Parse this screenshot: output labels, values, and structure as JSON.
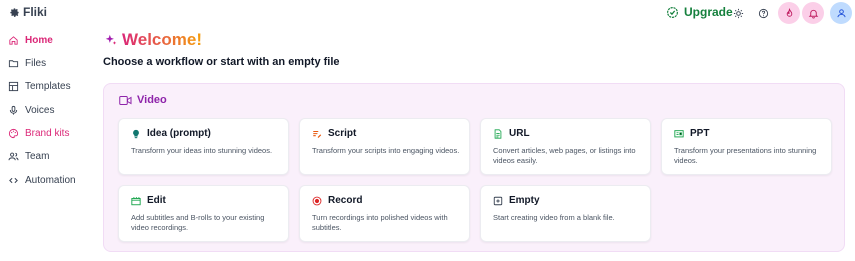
{
  "app": {
    "brand": "Fliki"
  },
  "topbar": {
    "upgrade_label": "Upgrade"
  },
  "sidebar": {
    "items": [
      {
        "label": "Home",
        "icon": "home-icon",
        "active": true
      },
      {
        "label": "Files",
        "icon": "folder-icon"
      },
      {
        "label": "Templates",
        "icon": "templates-icon"
      },
      {
        "label": "Voices",
        "icon": "microphone-icon"
      },
      {
        "label": "Brand kits",
        "icon": "palette-icon"
      },
      {
        "label": "Team",
        "icon": "users-icon"
      },
      {
        "label": "Automation",
        "icon": "code-icon"
      }
    ]
  },
  "main": {
    "welcome": "Welcome!",
    "subtitle": "Choose a workflow or start with an empty file",
    "section": {
      "title": "Video",
      "cards": [
        {
          "title": "Idea (prompt)",
          "desc": "Transform your ideas into stunning videos.",
          "icon": "lightbulb-icon",
          "color": "#0f766e"
        },
        {
          "title": "Script",
          "desc": "Transform your scripts into engaging videos.",
          "icon": "script-icon",
          "color": "#ea580c"
        },
        {
          "title": "URL",
          "desc": "Convert articles, web pages, or listings into videos easily.",
          "icon": "document-icon",
          "color": "#16a34a"
        },
        {
          "title": "PPT",
          "desc": "Transform your presentations into stunning videos.",
          "icon": "presentation-icon",
          "color": "#16a34a"
        },
        {
          "title": "Edit",
          "desc": "Add subtitles and B-rolls to your existing video recordings.",
          "icon": "edit-video-icon",
          "color": "#16a34a"
        },
        {
          "title": "Record",
          "desc": "Turn recordings into polished videos with subtitles.",
          "icon": "record-icon",
          "color": "#dc2626"
        },
        {
          "title": "Empty",
          "desc": "Start creating video from a blank file.",
          "icon": "plus-square-icon",
          "color": "#374151"
        }
      ]
    }
  },
  "colors": {
    "accent": "#db2777",
    "video": "#8e24aa",
    "upgrade": "#15803d"
  }
}
